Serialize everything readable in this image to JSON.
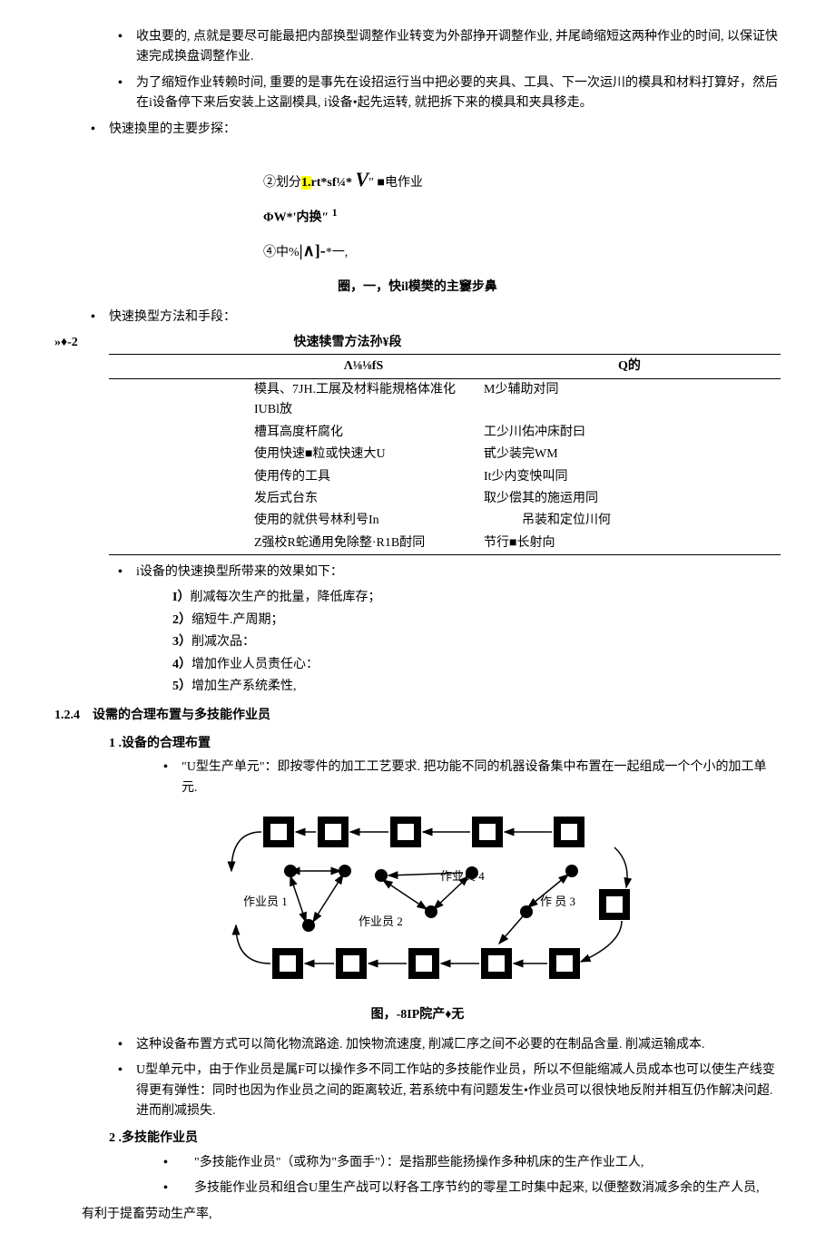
{
  "bullets_top": [
    "收虫要的, 点就是要尽可能最把内部换型调整作业转变为外部挣开调整作业, 并尾崎缩短这两种作业的时间, 以保证快速完成换盘调整作业.",
    "为了缩短作业转赖时间, 重要的是事先在设招运行当中把必要的夹具、工具、下一次运川的模具和材料打算好，然后在i设备停下来后安装上这副模具, i设备•起先运转, 就把拆下来的模具和夹具移走。",
    "快速換里的主要步探："
  ],
  "formula": {
    "l1_a": "②划分",
    "l1_hl": "1.",
    "l1_b": "rt*sf¼* ",
    "l1_v": "V",
    "l1_c": "″ ■电作业",
    "l2_a": "ΦW*'内换″ ",
    "l2_sup": "1",
    "l3_a": "④中%",
    "l3_b": "|∧]-",
    "l3_c": "*一,"
  },
  "caption1": "圈，一，快il模樊的主窶步鼻",
  "bullet_method": "快速换型方法和手段：",
  "table_label_left": "»♦-2",
  "table_label_right": "快速犊雪方法孙¥段",
  "table": {
    "header": [
      "Λ⅛⅛fS",
      "Q的"
    ],
    "rows": [
      [
        "模具、7JH.工展及材料能規格体准化IUBl放",
        "M少辅助对同"
      ],
      [
        "槽耳高度杆腐化",
        "工少川佑冲床酎曰"
      ],
      [
        "使用快速■粒或快速大U",
        "甙少装完WM"
      ],
      [
        "使用传的工具",
        "It少内变怏叫同"
      ],
      [
        "发后式台东",
        "取少偿其的施运用同"
      ],
      [
        "使用的就供号林利号In",
        "　　　吊装和定位川何"
      ],
      [
        "Z强校R蛇通用免除整·R1B酎同",
        "节行■长射向"
      ]
    ]
  },
  "effects_intro": "i设备的快速换型所带来的效果如下：",
  "effects": [
    "削减每次生产的批量，降低库存；",
    "缩短牛.产周期；",
    "削减次品：",
    "增加作业人员责任心：",
    "增加生产系统柔性,"
  ],
  "effects_nums": [
    "I）",
    "2）",
    "3）",
    "4）",
    "5）"
  ],
  "section_124": "1.2.4　设需的合理布置与多技能作业员",
  "sub1": "1 .设备的合理布置",
  "u_cell_bullet": "\"U型生产单元\"：即按零件的加工工艺要求. 把功能不同的机器设备集中布置在一起组成一个个小的加工单元.",
  "diagram_labels": {
    "w1": "作业员 1",
    "w2": "作业员 2",
    "w3": "作  员 3",
    "w4": "作业员 4"
  },
  "caption2": "图，-8IP院产♦无",
  "bullets_after_diagram": [
    "这种设备布置方式可以简化物流路途. 加怏物流速度, 削减匚序之间不必要的在制品含量. 削减运输成本.",
    "U型单元中，由于作业员是属F可以操作多不同工作站的多技能作业员，所以不但能缩减人员成本也可以使生产线变得更有弹性：同时也因为作业员之间的距离较近, 若系统中有问题发生•作业员可以很快地反附并相互仍作解决问超. 进而削减损失."
  ],
  "sub2": "2 .多技能作业员",
  "multi_skill_bullets": [
    "　\"多技能作业员\"（或称为\"多面手\"）：是指那些能扬操作多种机床的生产作业工人,",
    "　多技能作业员和组合U里生产战可以籽各工序节约的零星工时集中起来, 以便整数消减多余的生产人员,"
  ],
  "final_line": "有利于提畜劳动生产率,"
}
